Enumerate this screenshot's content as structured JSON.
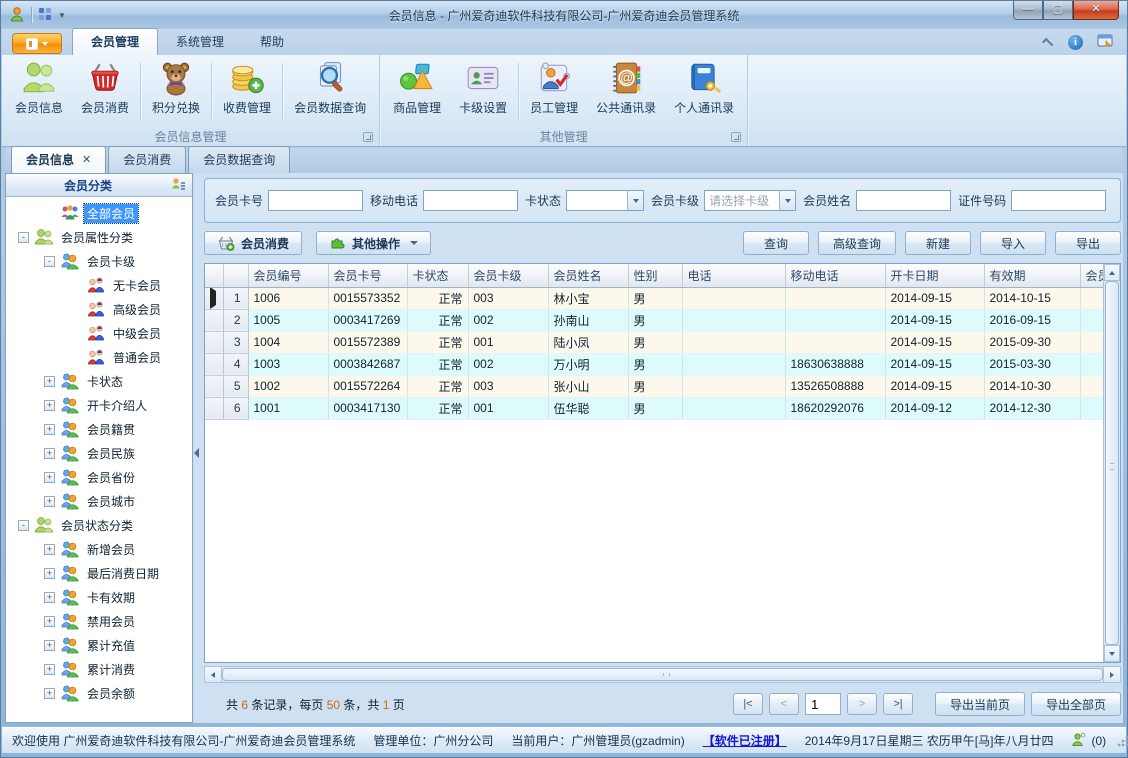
{
  "titlebar": {
    "title": "会员信息 - 广州爱奇迪软件科技有限公司-广州爱奇迪会员管理系统"
  },
  "ribbon": {
    "tabs": [
      "会员管理",
      "系统管理",
      "帮助"
    ],
    "active_tab": "会员管理",
    "groups": [
      {
        "label": "会员信息管理",
        "buttons": [
          "会员信息",
          "会员消费",
          "积分兑换",
          "收费管理",
          "会员数据查询"
        ]
      },
      {
        "label": "其他管理",
        "buttons": [
          "商品管理",
          "卡级设置",
          "员工管理",
          "公共通讯录",
          "个人通讯录"
        ]
      }
    ]
  },
  "doc_tabs": [
    "会员信息",
    "会员消费",
    "会员数据查询"
  ],
  "sidebar": {
    "header": "会员分类",
    "tree": [
      {
        "label": "全部会员",
        "indent": 1,
        "icon": "all-members",
        "selected": true
      },
      {
        "label": "会员属性分类",
        "indent": 0,
        "expander": "-",
        "icon": "green-people"
      },
      {
        "label": "会员卡级",
        "indent": 1,
        "expander": "-",
        "icon": "cat-pair"
      },
      {
        "label": "无卡会员",
        "indent": 2,
        "icon": "member-couple"
      },
      {
        "label": "高级会员",
        "indent": 2,
        "icon": "member-couple"
      },
      {
        "label": "中级会员",
        "indent": 2,
        "icon": "member-couple"
      },
      {
        "label": "普通会员",
        "indent": 2,
        "icon": "member-couple"
      },
      {
        "label": "卡状态",
        "indent": 1,
        "expander": "+",
        "icon": "cat-pair"
      },
      {
        "label": "开卡介绍人",
        "indent": 1,
        "expander": "+",
        "icon": "cat-pair"
      },
      {
        "label": "会员籍贯",
        "indent": 1,
        "expander": "+",
        "icon": "cat-pair"
      },
      {
        "label": "会员民族",
        "indent": 1,
        "expander": "+",
        "icon": "cat-pair"
      },
      {
        "label": "会员省份",
        "indent": 1,
        "expander": "+",
        "icon": "cat-pair"
      },
      {
        "label": "会员城市",
        "indent": 1,
        "expander": "+",
        "icon": "cat-pair"
      },
      {
        "label": "会员状态分类",
        "indent": 0,
        "expander": "-",
        "icon": "green-people"
      },
      {
        "label": "新增会员",
        "indent": 1,
        "expander": "+",
        "icon": "cat-pair"
      },
      {
        "label": "最后消费日期",
        "indent": 1,
        "expander": "+",
        "icon": "cat-pair"
      },
      {
        "label": "卡有效期",
        "indent": 1,
        "expander": "+",
        "icon": "cat-pair"
      },
      {
        "label": "禁用会员",
        "indent": 1,
        "expander": "+",
        "icon": "cat-pair"
      },
      {
        "label": "累计充值",
        "indent": 1,
        "expander": "+",
        "icon": "cat-pair"
      },
      {
        "label": "累计消费",
        "indent": 1,
        "expander": "+",
        "icon": "cat-pair"
      },
      {
        "label": "会员余额",
        "indent": 1,
        "expander": "+",
        "icon": "cat-pair"
      }
    ]
  },
  "search": {
    "fields": [
      {
        "label": "会员卡号",
        "type": "input",
        "value": ""
      },
      {
        "label": "移动电话",
        "type": "input",
        "value": ""
      },
      {
        "label": "卡状态",
        "type": "select",
        "value": ""
      },
      {
        "label": "会员卡级",
        "type": "select",
        "value": "请选择卡级"
      },
      {
        "label": "会员姓名",
        "type": "input",
        "value": ""
      },
      {
        "label": "证件号码",
        "type": "input",
        "value": ""
      }
    ]
  },
  "toolbar": {
    "member_consume": "会员消费",
    "other_ops": "其他操作",
    "actions": [
      "查询",
      "高级查询",
      "新建",
      "导入",
      "导出"
    ]
  },
  "table": {
    "columns": [
      "会员编号",
      "会员卡号",
      "卡状态",
      "会员卡级",
      "会员姓名",
      "性别",
      "电话",
      "移动电话",
      "开卡日期",
      "有效期",
      "会员"
    ],
    "rows": [
      {
        "num": "1",
        "cells": [
          "1006",
          "0015573352",
          "正常",
          "003",
          "林小宝",
          "男",
          "",
          "",
          "2014-09-15",
          "2014-10-15",
          ""
        ],
        "selected": true
      },
      {
        "num": "2",
        "cells": [
          "1005",
          "0003417269",
          "正常",
          "002",
          "孙南山",
          "男",
          "",
          "",
          "2014-09-15",
          "2016-09-15",
          ""
        ]
      },
      {
        "num": "3",
        "cells": [
          "1004",
          "0015572389",
          "正常",
          "001",
          "陆小凤",
          "男",
          "",
          "",
          "2014-09-15",
          "2015-09-30",
          ""
        ]
      },
      {
        "num": "4",
        "cells": [
          "1003",
          "0003842687",
          "正常",
          "002",
          "万小明",
          "男",
          "",
          "18630638888",
          "2014-09-15",
          "2015-03-30",
          ""
        ]
      },
      {
        "num": "5",
        "cells": [
          "1002",
          "0015572264",
          "正常",
          "003",
          "张小山",
          "男",
          "",
          "13526508888",
          "2014-09-15",
          "2014-10-30",
          ""
        ]
      },
      {
        "num": "6",
        "cells": [
          "1001",
          "0003417130",
          "正常",
          "001",
          "伍华聪",
          "男",
          "",
          "18620292076",
          "2014-09-12",
          "2014-12-30",
          ""
        ]
      }
    ]
  },
  "pagination": {
    "summary": [
      {
        "text": "共 "
      },
      {
        "text": "6",
        "accent": true
      },
      {
        "text": " 条记录，每页 "
      },
      {
        "text": "50",
        "accent": true
      },
      {
        "text": " 条，共 "
      },
      {
        "text": "1",
        "accent": true
      },
      {
        "text": " 页"
      }
    ],
    "first": "|<",
    "prev": "<",
    "page": "1",
    "next": ">",
    "last": ">|",
    "export_current": "导出当前页",
    "export_all": "导出全部页"
  },
  "statusbar": {
    "welcome": "欢迎使用 广州爱奇迪软件科技有限公司-广州爱奇迪会员管理系统",
    "org": "管理单位：广州分公司",
    "user": "当前用户：广州管理员(gzadmin)",
    "registered": "【软件已注册】",
    "date": "2014年9月17日星期三 农历甲午[马]年八月廿四",
    "messages": "(0)"
  },
  "colors": {
    "accent_orange": "#f7a428",
    "selected_blue": "#3e95fa",
    "row_odd": "#fcf8ec",
    "row_even": "#defbfb",
    "link_blue": "#1414d8",
    "summary_accent": "#c96a10"
  }
}
